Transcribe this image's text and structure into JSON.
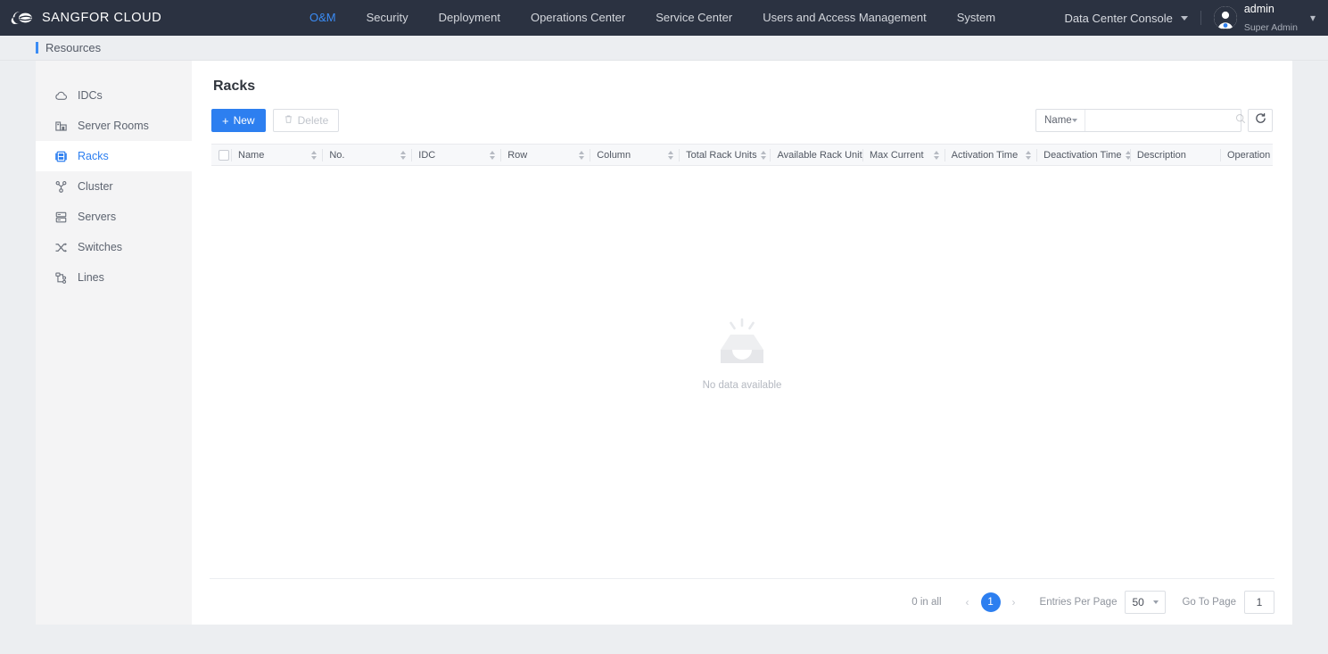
{
  "header": {
    "brand": "SANGFOR CLOUD",
    "logo_icon": "cloud-logo-icon",
    "nav": [
      {
        "label": "O&M",
        "active": true
      },
      {
        "label": "Security",
        "active": false
      },
      {
        "label": "Deployment",
        "active": false
      },
      {
        "label": "Operations Center",
        "active": false
      },
      {
        "label": "Service Center",
        "active": false
      },
      {
        "label": "Users and Access Management",
        "active": false
      },
      {
        "label": "System",
        "active": false
      }
    ],
    "console_selector": "Data Center Console",
    "user": {
      "name": "admin",
      "role": "Super Admin"
    },
    "accent_color": "#3b8cf5",
    "background_color": "#2b3241"
  },
  "breadcrumb": {
    "label": "Resources"
  },
  "sidebar": {
    "items": [
      {
        "label": "IDCs",
        "icon": "cloud-icon",
        "active": false
      },
      {
        "label": "Server Rooms",
        "icon": "building-icon",
        "active": false
      },
      {
        "label": "Racks",
        "icon": "rack-icon",
        "active": true
      },
      {
        "label": "Cluster",
        "icon": "cluster-icon",
        "active": false
      },
      {
        "label": "Servers",
        "icon": "servers-icon",
        "active": false
      },
      {
        "label": "Switches",
        "icon": "switches-icon",
        "active": false
      },
      {
        "label": "Lines",
        "icon": "lines-icon",
        "active": false
      }
    ]
  },
  "main": {
    "title": "Racks",
    "toolbar": {
      "new_label": "New",
      "new_icon": "plus-icon",
      "delete_label": "Delete",
      "delete_icon": "trash-icon",
      "delete_disabled": true
    },
    "search": {
      "field_label": "Name",
      "field_icon": "chevron-down-icon",
      "value": "",
      "placeholder": "",
      "search_icon": "search-icon",
      "refresh_icon": "refresh-icon"
    },
    "table": {
      "select_all_checkbox": "",
      "columns": [
        {
          "label": "Name",
          "sortable": true,
          "width": "8.5%"
        },
        {
          "label": "No.",
          "sortable": true,
          "width": "8.3%"
        },
        {
          "label": "IDC",
          "sortable": true,
          "width": "8.3%"
        },
        {
          "label": "Row",
          "sortable": true,
          "width": "8.3%"
        },
        {
          "label": "Column",
          "sortable": true,
          "width": "8.3%"
        },
        {
          "label": "Total Rack Units",
          "sortable": true,
          "width": "8.5%"
        },
        {
          "label": "Available Rack Units",
          "sortable": false,
          "width": "8.6%"
        },
        {
          "label": "Max Current",
          "sortable": true,
          "width": "7.6%"
        },
        {
          "label": "Activation Time",
          "sortable": true,
          "width": "8.6%"
        },
        {
          "label": "Deactivation Time",
          "sortable": true,
          "width": "8.7%"
        },
        {
          "label": "Description",
          "sortable": false,
          "width": "8.4%"
        },
        {
          "label": "Operation",
          "sortable": false,
          "width": "7.9%"
        }
      ],
      "rows": [],
      "empty_text": "No data available",
      "empty_icon": "empty-box-icon"
    },
    "pagination": {
      "total_text": "0 in all",
      "prev_icon": "chevron-left-icon",
      "next_icon": "chevron-right-icon",
      "current_page": "1",
      "per_page_label": "Entries Per Page",
      "per_page_value": "50",
      "goto_label": "Go To Page",
      "goto_value": "1"
    }
  }
}
